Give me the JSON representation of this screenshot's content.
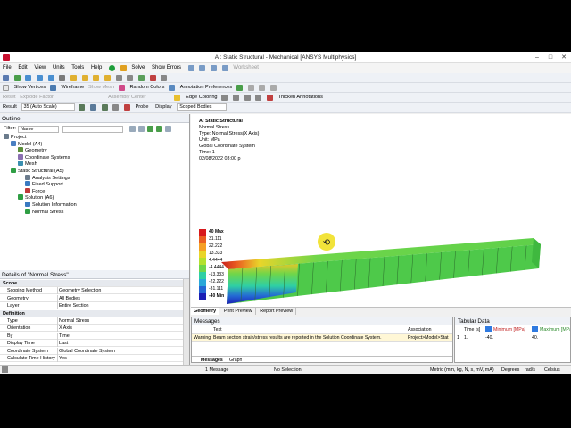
{
  "window": {
    "title": "A : Static Structural - Mechanical [ANSYS Multiphysics]"
  },
  "menu": [
    "File",
    "Edit",
    "View",
    "Units",
    "Tools",
    "Help"
  ],
  "toolbar1": {
    "solve": "Solve",
    "show_errors": "Show Errors",
    "worksheet": "Worksheet"
  },
  "toolbar2": {
    "show_vertices": "Show Vertices",
    "wireframe": "Wireframe",
    "show_mesh": "Show Mesh",
    "random_colors": "Random Colors",
    "annotation_prefs": "Annotation Preferences"
  },
  "toolbar3": {
    "reset": "Reset",
    "explode_factor": "Explode Factor:",
    "assembly_center": "Assembly Center",
    "edge_coloring": "Edge Coloring",
    "thicken": "Thicken Annotations"
  },
  "toolbar4": {
    "result_label": "Result",
    "result_value": "35 (Auto Scale)",
    "probe": "Probe",
    "display_label": "Display",
    "display_value": "Scoped Bodies"
  },
  "outline": {
    "title": "Outline",
    "filter_label": "Filter:",
    "filter_value": "Name",
    "tree": [
      {
        "label": "Project",
        "level": 0,
        "color": "#6b7b8c"
      },
      {
        "label": "Model (A4)",
        "level": 1,
        "color": "#4a7fc1"
      },
      {
        "label": "Geometry",
        "level": 2,
        "color": "#5c8f3a"
      },
      {
        "label": "Coordinate Systems",
        "level": 2,
        "color": "#8a6fb0"
      },
      {
        "label": "Mesh",
        "level": 2,
        "color": "#3a8fb0"
      },
      {
        "label": "Static Structural (A5)",
        "level": 1,
        "color": "#2f9e44"
      },
      {
        "label": "Analysis Settings",
        "level": 3,
        "color": "#6b7b8c"
      },
      {
        "label": "Fixed Support",
        "level": 3,
        "color": "#3a7ac1"
      },
      {
        "label": "Force",
        "level": 3,
        "color": "#c13a3a"
      },
      {
        "label": "Solution (A6)",
        "level": 2,
        "color": "#2f9e44"
      },
      {
        "label": "Solution Information",
        "level": 3,
        "color": "#3a7ac1"
      },
      {
        "label": "Normal Stress",
        "level": 3,
        "color": "#2f9e44"
      }
    ]
  },
  "details": {
    "title": "Details of \"Normal Stress\"",
    "rows": [
      {
        "key": "Scope",
        "value": "",
        "header": true
      },
      {
        "key": "Scoping Method",
        "value": "Geometry Selection"
      },
      {
        "key": "Geometry",
        "value": "All Bodies"
      },
      {
        "key": "Layer",
        "value": "Entire Section"
      },
      {
        "key": "Definition",
        "value": "",
        "header": true
      },
      {
        "key": "Type",
        "value": "Normal Stress"
      },
      {
        "key": "Orientation",
        "value": "X Axis"
      },
      {
        "key": "By",
        "value": "Time"
      },
      {
        "key": "Display Time",
        "value": "Last"
      },
      {
        "key": "Coordinate System",
        "value": "Global Coordinate System"
      },
      {
        "key": "Calculate Time History",
        "value": "Yes"
      }
    ]
  },
  "viewport": {
    "info": [
      "A: Static Structural",
      "Normal Stress",
      "Type: Normal Stress(X Axis)",
      "Unit: MPa",
      "Global Coordinate System",
      "Time: 1",
      "02/08/2022 03:00 p"
    ],
    "legend": [
      "40 Max",
      "31.111",
      "22.222",
      "13.333",
      "4.4444",
      "-4.4444",
      "-13.333",
      "-22.222",
      "-31.111",
      "-40 Min"
    ],
    "legend_colors": [
      "#d7191c",
      "#ea5f21",
      "#f59f24",
      "#e9d52a",
      "#b4e12f",
      "#6fd64a",
      "#2fcfa4",
      "#2aa8d9",
      "#2468d4",
      "#1b1fb5"
    ],
    "scale": {
      "ticks_top": [
        "0.00",
        "200.00",
        "400.00 (mm)"
      ],
      "ticks_bottom": [
        "100.00",
        "300.00"
      ]
    },
    "tabs": [
      "Geometry",
      "Print Preview",
      "Report Preview"
    ]
  },
  "messages": {
    "title": "Messages",
    "columns": [
      "Text",
      "Association"
    ],
    "row": {
      "type": "Warning",
      "text": "Beam section strain/stress results are reported in the Solution Coordinate System.",
      "assoc": "Project>Model>Stat"
    },
    "tabs": [
      "Messages",
      "Graph"
    ]
  },
  "tabular": {
    "title": "Tabular Data",
    "columns": [
      "Time [s]",
      "Minimum [MPa]",
      "Maximum [MPa]"
    ],
    "row": {
      "idx": "1",
      "time": "1.",
      "min": "-40.",
      "max": "40."
    }
  },
  "status": {
    "messages": "1 Message",
    "selection": "No Selection",
    "units": "Metric (mm, kg, N, s, mV, mA)",
    "angle": "Degrees",
    "rate": "rad/s",
    "temp": "Celsius"
  }
}
